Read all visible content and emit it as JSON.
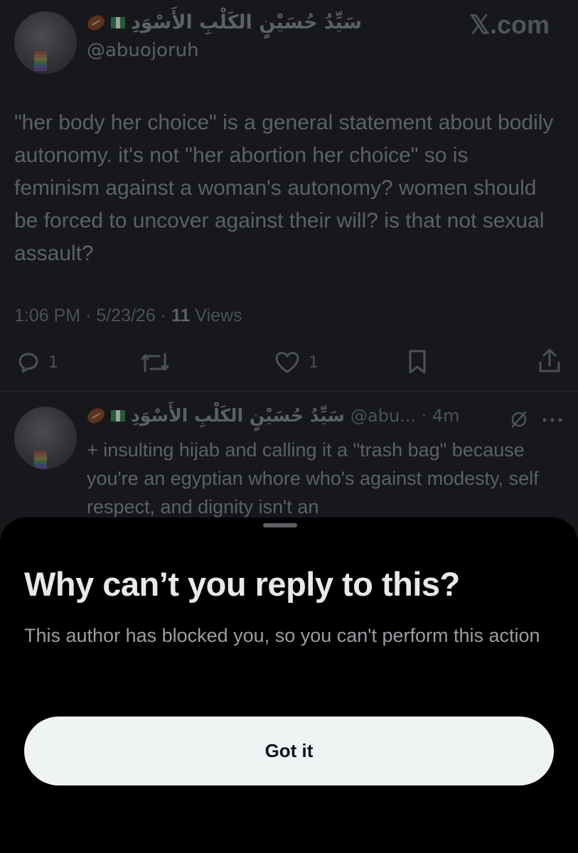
{
  "brand": {
    "watermark": "𝕏.com"
  },
  "tweet": {
    "author_name": "سَيِّدُ حُسَيْنٍ الكَلْبِ الأَسْوَدِ",
    "handle": "@abuojoruh",
    "body": "\"her body her choice\" is a general statement about bodily autonomy. it's not \"her abortion her choice\" so is feminism against a woman's autonomy? women should be forced to uncover against their will? is that not sexual assault?",
    "time": "1:06 PM · 5/23/26 · ",
    "views_count": "11",
    "views_label": "Views",
    "actions": {
      "reply_count": "1",
      "like_count": "1",
      "icons": [
        "reply-icon",
        "retweet-icon",
        "like-icon",
        "bookmark-icon",
        "share-icon"
      ]
    }
  },
  "reply": {
    "author_name": "سَيِّدُ حُسَيْنٍ الكَلْبِ الأَسْوَدِ",
    "handle_time": "@abu... · 4m",
    "body": "+ insulting hijab and calling it a \"trash bag\" because you're an egyptian whore who's against modesty, self respect, and dignity isn't an"
  },
  "sheet": {
    "title": "Why can’t you reply to this?",
    "message": "This author has blocked you, so you can't perform this action",
    "button_label": "Got it"
  },
  "colors": {
    "background": "#17181b",
    "sheet_background": "#000000",
    "button_background": "#eff3f4",
    "dim_text": "#5c6166"
  }
}
